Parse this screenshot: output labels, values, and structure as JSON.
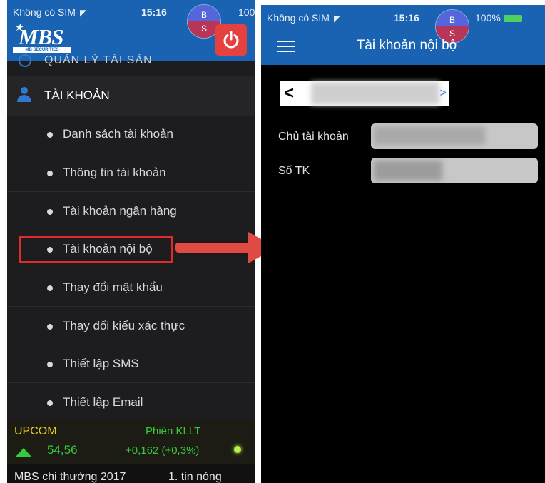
{
  "left_screen": {
    "status_bar": {
      "carrier": "Không có SIM",
      "time": "15:16",
      "battery": "100"
    },
    "badge": {
      "top": "B",
      "bottom": "S"
    },
    "logo": {
      "mark": "MBS",
      "sub": "MB SECURITIES"
    },
    "menu_cutoff_label": "QUẢN LÝ TÀI SẢN",
    "section_title": "TÀI KHOẢN",
    "menu_items": [
      {
        "label": "Danh sách tài khoản"
      },
      {
        "label": "Thông tin tài khoản"
      },
      {
        "label": "Tài khoản ngân hàng"
      },
      {
        "label": "Tài khoản nội bộ"
      },
      {
        "label": "Thay đổi mật khẩu"
      },
      {
        "label": "Thay đổi kiểu xác thực"
      },
      {
        "label": "Thiết lập SMS"
      },
      {
        "label": "Thiết lập Email"
      }
    ],
    "highlighted_item": "Tài khoản nội bộ",
    "ticker": {
      "index": "UPCOM",
      "session": "Phiên KLLT",
      "price": "54,56",
      "change": "+0,162 (+0,3%)"
    },
    "news": {
      "headline": "MBS chi thưởng 2017",
      "tag": "1. tin nóng"
    }
  },
  "right_screen": {
    "status_bar": {
      "carrier": "Không có SIM",
      "time": "15:16",
      "battery": "100%"
    },
    "badge": {
      "top": "B",
      "bottom": "S"
    },
    "title": "Tài khoản nội bộ",
    "account_selector": {
      "prev": "<",
      "next": ">"
    },
    "fields": [
      {
        "label": "Chủ tài khoản"
      },
      {
        "label": "Số TK"
      }
    ]
  },
  "colors": {
    "header_blue": "#1a63b3",
    "menu_dark": "#1d1d1f",
    "highlight_red": "#e12a2a",
    "ticker_yellow": "#e4cd22",
    "ticker_green": "#37c93c",
    "power_red": "#e5413f"
  },
  "icons": [
    "wifi-icon",
    "power-icon",
    "user-icon",
    "hamburger-icon",
    "chevron-left-icon",
    "chevron-right-icon",
    "arrow-right-icon",
    "up-arrow-icon",
    "battery-icon"
  ]
}
